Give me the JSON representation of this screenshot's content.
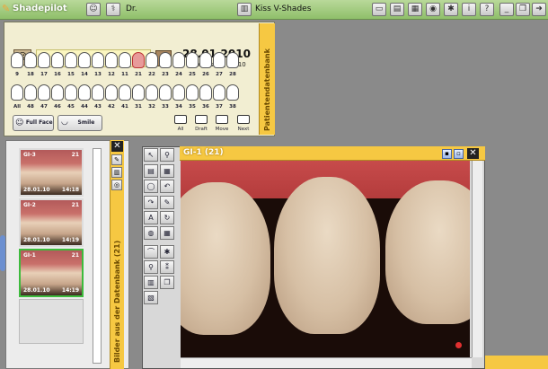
{
  "app": {
    "title": "Shadepilot",
    "user": "Dr.",
    "shade_guide": "Kiss V-Shades"
  },
  "patient": {
    "name": "",
    "date": "28.01.2010",
    "day_time": "Donnerstag, 11:10",
    "upper_numbers": [
      "9",
      "18",
      "17",
      "16",
      "15",
      "14",
      "13",
      "12",
      "11",
      "21",
      "22",
      "23",
      "24",
      "25",
      "26",
      "27",
      "28"
    ],
    "lower_numbers": [
      "All",
      "48",
      "47",
      "46",
      "45",
      "44",
      "43",
      "42",
      "41",
      "31",
      "32",
      "33",
      "34",
      "35",
      "36",
      "37",
      "38"
    ],
    "selected_tooth": "21",
    "side_label": "Patientendatenbank",
    "buttons": {
      "full_face": "Full Face",
      "smile": "Smile",
      "all": "All",
      "draft": "Draft",
      "move": "Move",
      "next": "Next"
    }
  },
  "thumbnails": [
    {
      "id": "GI-3",
      "tooth": "21",
      "date": "28.01.10",
      "time": "14:18"
    },
    {
      "id": "GI-2",
      "tooth": "21",
      "date": "28.01.10",
      "time": "14:19"
    },
    {
      "id": "GI-1",
      "tooth": "21",
      "date": "28.01.10",
      "time": "14:19"
    }
  ],
  "db_panel": {
    "side_label": "Bilder aus der Datenbank (21)"
  },
  "image_window": {
    "title": "GI-1 (21)"
  },
  "colors": {
    "accent": "#f6c842",
    "topbar": "#a6cc80",
    "selected": "#e89a9a",
    "active_thumb": "#3dbb3d"
  }
}
